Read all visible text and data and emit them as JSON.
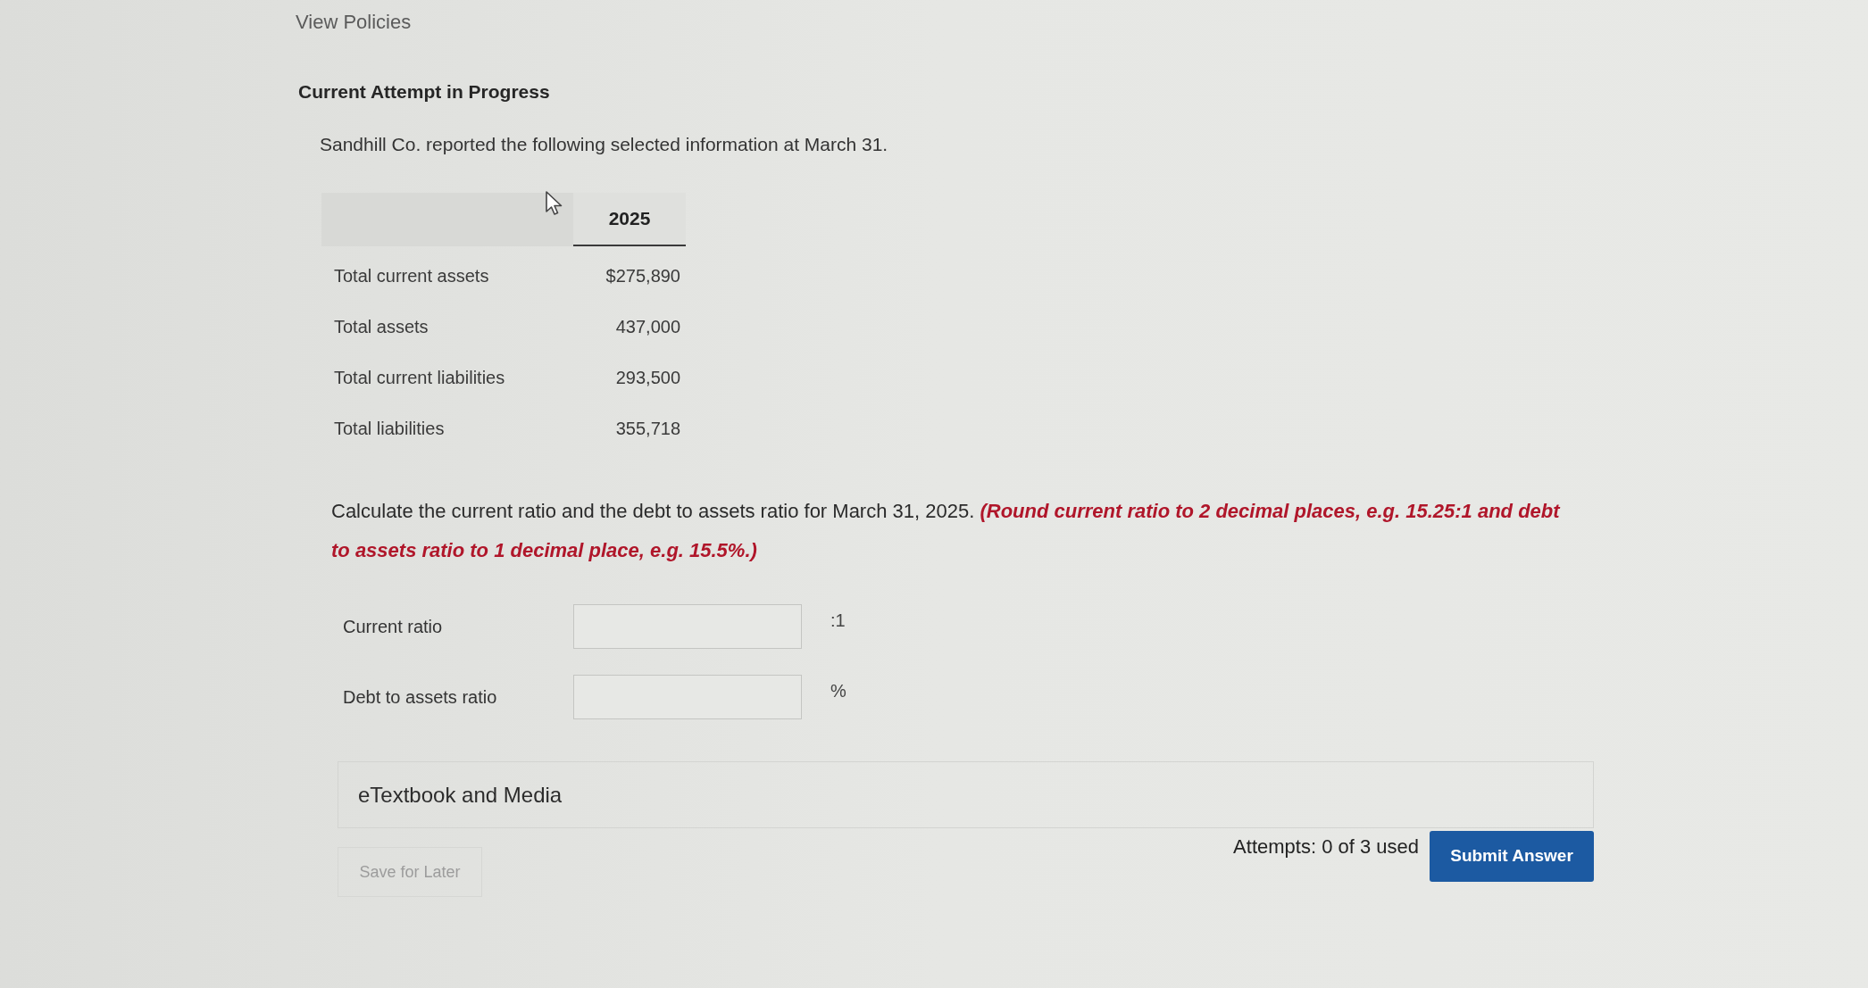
{
  "header_link": "View Policies",
  "attempt_title": "Current Attempt in Progress",
  "intro": "Sandhill Co. reported the following selected information at March 31.",
  "table": {
    "columns": [
      "2025"
    ],
    "rows": [
      {
        "label": "Total current assets",
        "value": "$275,890"
      },
      {
        "label": "Total assets",
        "value": "437,000"
      },
      {
        "label": "Total current liabilities",
        "value": "293,500"
      },
      {
        "label": "Total liabilities",
        "value": "355,718"
      }
    ]
  },
  "question": {
    "text": "Calculate the current ratio and the debt to assets ratio for March 31, 2025.",
    "instruction": "(Round current ratio to 2 decimal places, e.g. 15.25:1 and debt to assets ratio to 1 decimal place, e.g. 15.5%.)"
  },
  "answers": [
    {
      "label": "Current ratio",
      "unit": ":1"
    },
    {
      "label": "Debt to assets ratio",
      "unit": "%"
    }
  ],
  "etextbook": "eTextbook and Media",
  "save_button": "Save for Later",
  "attempts": "Attempts: 0 of 3 used",
  "submit_button": "Submit Answer"
}
